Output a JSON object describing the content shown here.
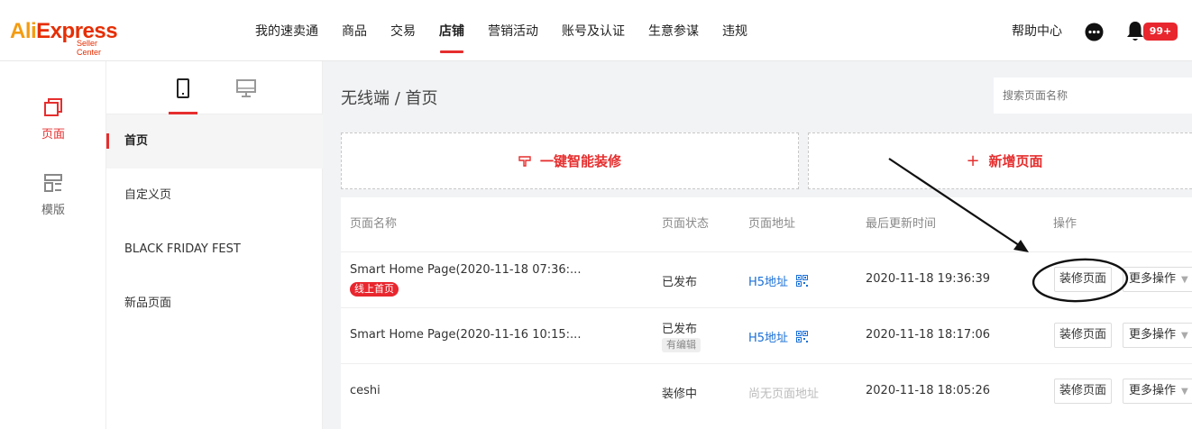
{
  "brand": {
    "name_a": "Ali",
    "name_b": "Express",
    "sub": "Seller Center"
  },
  "nav": {
    "items": [
      {
        "label": "我的速卖通",
        "active": false
      },
      {
        "label": "商品",
        "active": false
      },
      {
        "label": "交易",
        "active": false
      },
      {
        "label": "店铺",
        "active": true
      },
      {
        "label": "营销活动",
        "active": false
      },
      {
        "label": "账号及认证",
        "active": false
      },
      {
        "label": "生意参谋",
        "active": false
      },
      {
        "label": "违规",
        "active": false
      }
    ],
    "help": "帮助中心",
    "badge": "99+"
  },
  "rail": {
    "pages": "页面",
    "templates": "模版"
  },
  "panel": {
    "pages": [
      {
        "label": "首页",
        "active": true
      },
      {
        "label": "自定义页",
        "active": false
      },
      {
        "label": "BLACK FRIDAY FEST",
        "active": false
      },
      {
        "label": "新品页面",
        "active": false
      }
    ]
  },
  "main": {
    "title": "无线端 / 首页",
    "search_placeholder": "搜索页面名称",
    "smart_decorate": "一键智能装修",
    "add_page": "新增页面"
  },
  "table": {
    "headers": {
      "name": "页面名称",
      "status": "页面状态",
      "url": "页面地址",
      "updated": "最后更新时间",
      "actions": "操作"
    },
    "rows": [
      {
        "name": "Smart Home Page(2020-11-18 07:36:...",
        "tag": "线上首页",
        "status": "已发布",
        "status_tag": "",
        "url": "H5地址",
        "updated": "2020-11-18 19:36:39",
        "edit": "装修页面",
        "more": "更多操作"
      },
      {
        "name": "Smart Home Page(2020-11-16 10:15:...",
        "tag": "",
        "status": "已发布",
        "status_tag": "有编辑",
        "url": "H5地址",
        "updated": "2020-11-18 18:17:06",
        "edit": "装修页面",
        "more": "更多操作"
      },
      {
        "name": "ceshi",
        "tag": "",
        "status": "装修中",
        "status_tag": "",
        "url": "尚无页面地址",
        "updated": "2020-11-18 18:05:26",
        "edit": "装修页面",
        "more": "更多操作"
      }
    ]
  },
  "colors": {
    "accent": "#e62e2e",
    "link": "#1a6fd6",
    "brand_orange": "#f39c12"
  }
}
